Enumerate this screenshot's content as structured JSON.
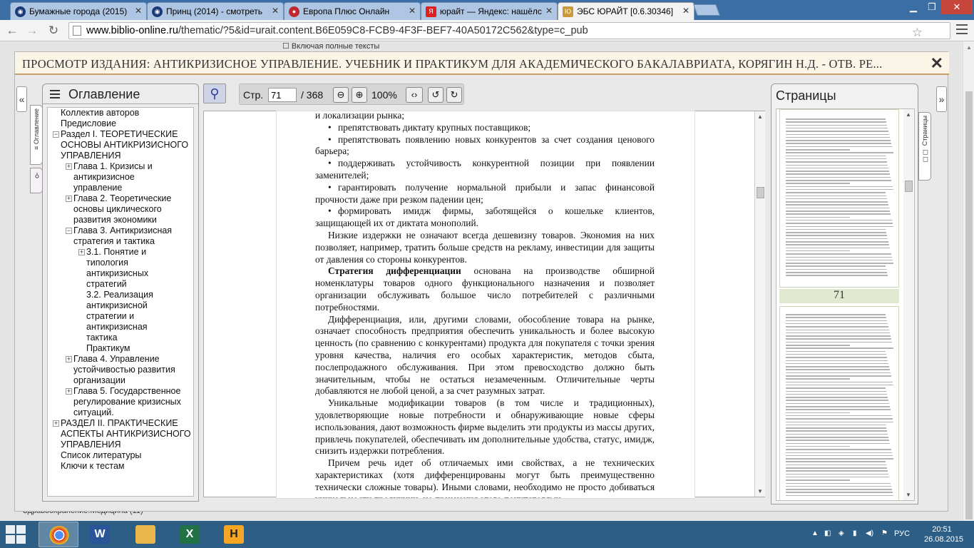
{
  "tabs": [
    {
      "label": "Бумажные города (2015)",
      "icon": "tv-icon",
      "active": false
    },
    {
      "label": "Принц (2014) - смотреть",
      "icon": "tv-icon",
      "active": false
    },
    {
      "label": "Европа Плюс Онлайн",
      "icon": "radio-icon",
      "active": false
    },
    {
      "label": "юрайт — Яндекс: нашёлс",
      "icon": "yandex-icon",
      "active": false
    },
    {
      "label": "ЭБС ЮРАЙТ [0.6.30346]",
      "icon": "urait-icon",
      "active": true
    }
  ],
  "address": {
    "host": "www.biblio-online.ru",
    "path": "/thematic/?5&id=urait.content.B6E059C8-FCB9-4F3F-BEF7-40A50172C562&type=c_pub"
  },
  "background": {
    "top_text": "Включая полные тексты",
    "bottom_text": "Здравоохранение.Медицина (11)"
  },
  "viewer": {
    "title": "ПРОСМОТР ИЗДАНИЯ: АНТИКРИЗИСНОЕ УПРАВЛЕНИЕ. УЧЕБНИК И ПРАКТИКУМ ДЛЯ АКАДЕМИЧЕСКОГО БАКАЛАВРИАТА, КОРЯГИН Н.Д. - ОТВ. РЕ...",
    "close": "✕",
    "left_collapse": "«",
    "right_collapse": "»",
    "toc_title": "Оглавление",
    "toc_vtab": "≡ Оглавление",
    "search_vtab": "⚲",
    "pages_title": "Страницы",
    "pages_vtab": "☐☐ Страницы",
    "page_label": "Стр.",
    "page_value": "71",
    "page_total": "/ 368",
    "zoom": "100%",
    "current_thumb": "71"
  },
  "toc": [
    {
      "text": "Коллектив авторов",
      "pm": ""
    },
    {
      "text": "Предисловие",
      "pm": ""
    },
    {
      "text": "Раздел I. ТЕОРЕТИЧЕСКИЕ ОСНОВЫ АНТИКРИЗИСНОГО УПРАВЛЕНИЯ",
      "pm": "−"
    },
    {
      "text": "Глава 1. Кризисы и антикризисное управление",
      "pm": "+"
    },
    {
      "text": "Глава 2. Теоретические основы циклического развития экономики",
      "pm": "+"
    },
    {
      "text": "Глава 3. Антикризисная стратегия и тактика",
      "pm": "−"
    },
    {
      "text": "3.1. Понятие и типология антикризисных стратегий",
      "pm": "+"
    },
    {
      "text": "3.2. Реализация антикризисной стратегии и антикризисная тактика",
      "pm": ""
    },
    {
      "text": "Практикум",
      "pm": ""
    },
    {
      "text": "Глава 4. Управление устойчивостью развития организации",
      "pm": "+"
    },
    {
      "text": "Глава 5. Государственное регулирование кризисных ситуаций.",
      "pm": "+"
    },
    {
      "text": "РАЗДЕЛ II. ПРАКТИЧЕСКИЕ АСПЕКТЫ АНТИКРИЗИСНОГО УПРАВЛЕНИЯ",
      "pm": "+"
    },
    {
      "text": "Список литературы",
      "pm": ""
    },
    {
      "text": "Ключи к тестам",
      "pm": ""
    }
  ],
  "doc": {
    "p0": "и локализации рынка;",
    "b1": "препятствовать диктату крупных поставщиков;",
    "b2": "препятствовать появлению новых конкурентов за счет создания ценового барьера;",
    "b3": "поддерживать устойчивость конкурентной позиции при появлении заменителей;",
    "b4": "гарантировать получение нормальной прибыли и запас финансовой прочности даже при резком падении цен;",
    "b5": "формировать имидж фирмы, заботящейся о кошельке клиентов, защищающей их от диктата монополий.",
    "p6": "Низкие издержки не означают всегда дешевизну товаров. Экономия на них позволяет, например, тратить больше средств на рекламу, инвестиции для защиты от давления со стороны конкурентов.",
    "p7_bold": "Стратегия дифференциации",
    "p7_rest": " основана на производстве обширной номенклатуры товаров одного функционального назначения и позволяет организации обслуживать большое число потребителей с различными потребностями.",
    "p8": "Дифференциация, или, другими словами, обособление товара на рынке, означает способность предприятия обеспечить уникальность и более высокую ценность (по сравнению с конкурентами) продукта для покупателя с точки зрения уровня качества, наличия его особых характеристик, методов сбыта, послепродажного обслуживания. При этом превосходство должно быть значительным, чтобы не остаться незамеченным. Отличительные черты добавляются не любой ценой, а за счет разумных затрат.",
    "p9": "Уникальные модификации товаров (в том числе и традиционных), удовлетворяющие новые потребности и обнаруживающие новые сферы использования, дают возможность фирме выделить эти продукты из массы других, привлечь покупателей, обеспечивать им дополнительные удобства, статус, имидж, снизить издержки потребления.",
    "p10": "Причем речь идет об отличаемых ими свойствах, а не технических характеристиках (хотя дифференцированы могут быть преимущественно технически сложные товары). Иными словами, необходимо не просто добиваться уникальности продукции, но признания этого покупателями."
  },
  "taskbar": {
    "apps": [
      {
        "name": "chrome-icon",
        "label": "",
        "active": true,
        "color": "#2f7a3b"
      },
      {
        "name": "word-icon",
        "label": "W",
        "active": false,
        "color": "#2a5699"
      },
      {
        "name": "explorer-icon",
        "label": "",
        "active": false,
        "color": "#e8b64a"
      },
      {
        "name": "excel-icon",
        "label": "X",
        "active": false,
        "color": "#217346"
      },
      {
        "name": "hotspot-icon",
        "label": "H",
        "active": false,
        "color": "#f5a623"
      }
    ],
    "lang": "РУС",
    "time": "20:51",
    "date": "26.08.2015"
  }
}
